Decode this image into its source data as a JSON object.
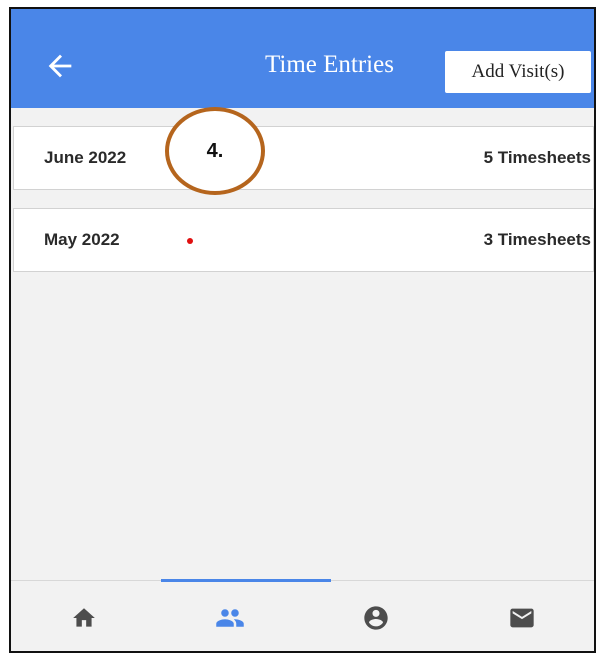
{
  "header": {
    "title": "Time Entries",
    "add_button_label": "Add Visit(s)"
  },
  "months": [
    {
      "label": "June 2022",
      "count": "5 Timesheets"
    },
    {
      "label": "May 2022",
      "count": "3 Timesheets"
    }
  ],
  "annotation": {
    "step": "4."
  },
  "bottom_nav": {
    "items": [
      {
        "icon": "home-icon",
        "active": false
      },
      {
        "icon": "people-icon",
        "active": true
      },
      {
        "icon": "account-icon",
        "active": false
      },
      {
        "icon": "mail-icon",
        "active": false
      }
    ]
  },
  "colors": {
    "header": "#4a86e8",
    "accent": "#4a86e8",
    "callout_border": "#b5651d",
    "dot": "#e01010"
  }
}
